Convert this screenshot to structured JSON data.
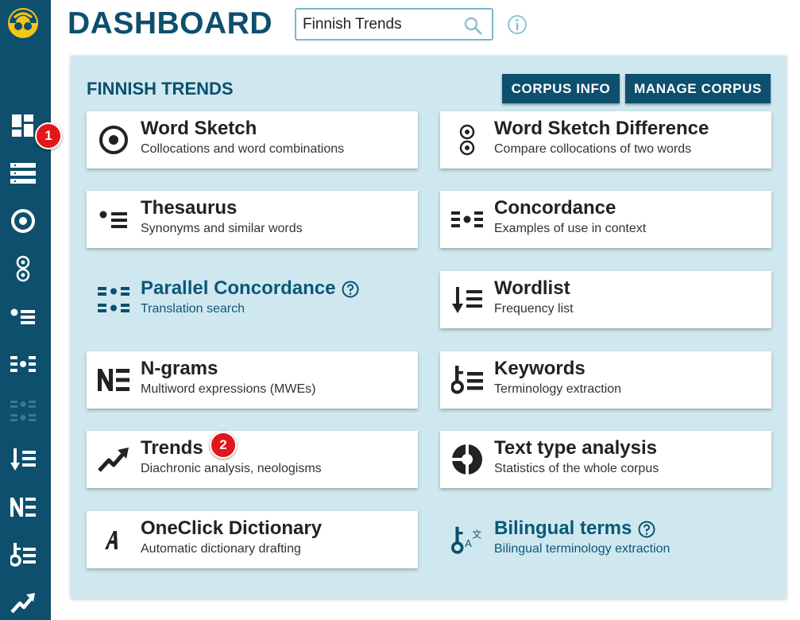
{
  "header": {
    "title": "DASHBOARD",
    "search_value": "Finnish Trends"
  },
  "sidebar": {
    "items": [
      {
        "icon": "dashboard-icon"
      },
      {
        "icon": "list-icon"
      },
      {
        "icon": "word-sketch-icon"
      },
      {
        "icon": "word-sketch-difference-icon"
      },
      {
        "icon": "thesaurus-icon"
      },
      {
        "icon": "concordance-icon"
      },
      {
        "icon": "parallel-concordance-icon"
      },
      {
        "icon": "wordlist-icon"
      },
      {
        "icon": "ngrams-icon"
      },
      {
        "icon": "keywords-icon"
      },
      {
        "icon": "trends-icon"
      }
    ]
  },
  "badges": {
    "one": "1",
    "two": "2"
  },
  "panel": {
    "title": "FINNISH TRENDS",
    "corpus_info_label": "CORPUS INFO",
    "manage_corpus_label": "MANAGE CORPUS"
  },
  "tools": {
    "word_sketch": {
      "title": "Word Sketch",
      "subtitle": "Collocations and word combinations"
    },
    "word_sketch_difference": {
      "title": "Word Sketch Difference",
      "subtitle": "Compare collocations of two words"
    },
    "thesaurus": {
      "title": "Thesaurus",
      "subtitle": "Synonyms and similar words"
    },
    "concordance": {
      "title": "Concordance",
      "subtitle": "Examples of use in context"
    },
    "parallel_concordance": {
      "title": "Parallel Concordance",
      "subtitle": "Translation search"
    },
    "wordlist": {
      "title": "Wordlist",
      "subtitle": "Frequency list"
    },
    "ngrams": {
      "title": "N-grams",
      "subtitle": "Multiword expressions (MWEs)"
    },
    "keywords": {
      "title": "Keywords",
      "subtitle": "Terminology extraction"
    },
    "trends": {
      "title": "Trends",
      "subtitle": "Diachronic analysis, neologisms"
    },
    "text_type_analysis": {
      "title": "Text type analysis",
      "subtitle": "Statistics of the whole corpus"
    },
    "oneclick_dictionary": {
      "title": "OneClick Dictionary",
      "subtitle": "Automatic dictionary drafting"
    },
    "bilingual_terms": {
      "title": "Bilingual terms",
      "subtitle": "Bilingual terminology extraction"
    }
  },
  "colors": {
    "sidebar": "#0d4f6d",
    "panel": "#cfe8f0",
    "accent": "#0d4f6d",
    "badge": "#e1171a",
    "logo_yellow": "#f5c518"
  }
}
